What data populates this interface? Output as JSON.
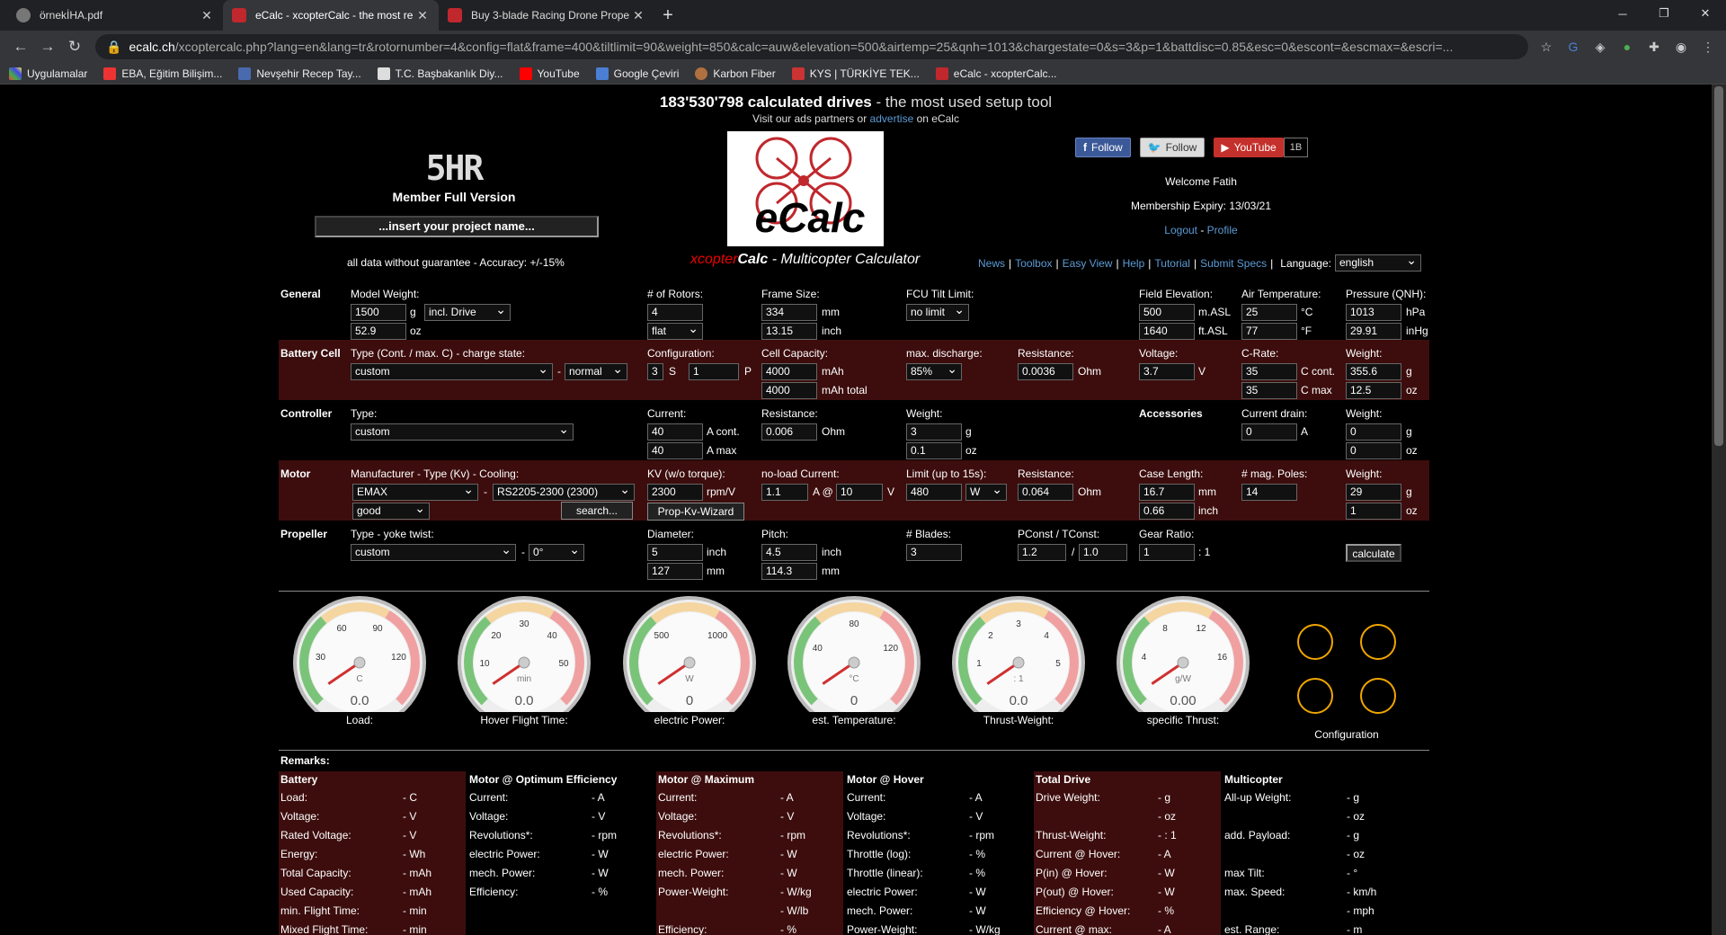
{
  "browser": {
    "tabs": [
      {
        "title": "örnekİHA.pdf",
        "color": "#777"
      },
      {
        "title": "eCalc - xcopterCalc - the most re",
        "color": "#c0282d"
      },
      {
        "title": "Buy 3-blade Racing Drone Prope",
        "color": "#c0282d"
      }
    ],
    "url_host": "ecalc.ch",
    "url_path": "/xcoptercalc.php?lang=en&lang=tr&rotornumber=4&config=flat&frame=400&tiltlimit=90&weight=850&calc=auw&elevation=500&airtemp=25&qnh=1013&chargestate=0&s=3&p=1&battdisc=0.85&esc=0&escont=&escmax=&escri=...",
    "bookmarks": [
      "Uygulamalar",
      "EBA, Eğitim Bilişim...",
      "Nevşehir Recep Tay...",
      "T.C. Başbakanlık Diy...",
      "YouTube",
      "Google Çeviri",
      "Karbon Fiber",
      "KYS | TÜRKİYE TEK...",
      "eCalc - xcopterCalc..."
    ]
  },
  "header": {
    "count": "183'530'798 calculated drives",
    "tagline": " - the most used setup tool",
    "ads_pre": "Visit our ads partners or ",
    "ads_link": "advertise",
    "ads_post": " on eCalc",
    "member_logo": "5HR",
    "member_text": "Member Full Version",
    "project_placeholder": "...insert your project name...",
    "guarantee": "all data without guarantee - Accuracy: +/-15%",
    "subtitle_x": "xcopter",
    "subtitle_calc": "Calc",
    "subtitle_rest": " - Multicopter Calculator",
    "logo_text": "eCalc"
  },
  "social": {
    "facebook": "Follow",
    "twitter": "Follow",
    "youtube": "YouTube",
    "yt_count": "1B"
  },
  "account": {
    "welcome": "Welcome Fatih",
    "expiry": "Membership Expiry: 13/03/21",
    "logout": "Logout",
    "profile": "Profile"
  },
  "nav": {
    "links": [
      "News",
      "Toolbox",
      "Easy View",
      "Help",
      "Tutorial",
      "Submit Specs"
    ],
    "language_label": "Language:",
    "language": "english"
  },
  "general": {
    "title": "General",
    "weight_label": "Model Weight:",
    "weight_g": "1500",
    "unit_g": "g",
    "drive_mode": "incl. Drive",
    "weight_oz": "52.9",
    "unit_oz": "oz",
    "rotors_label": "# of Rotors:",
    "rotors": "4",
    "config": "flat",
    "frame_label": "Frame Size:",
    "frame_mm": "334",
    "unit_mm": "mm",
    "frame_in": "13.15",
    "unit_inch": "inch",
    "tilt_label": "FCU Tilt Limit:",
    "tilt": "no limit",
    "elev_label": "Field Elevation:",
    "elev_m": "500",
    "unit_masl": "m.ASL",
    "elev_ft": "1640",
    "unit_ftasl": "ft.ASL",
    "temp_label": "Air Temperature:",
    "temp_c": "25",
    "unit_c": "°C",
    "temp_f": "77",
    "unit_f": "°F",
    "qnh_label": "Pressure (QNH):",
    "qnh_hpa": "1013",
    "unit_hpa": "hPa",
    "qnh_inhg": "29.91",
    "unit_inhg": "inHg"
  },
  "battery": {
    "title": "Battery Cell",
    "type_label": "Type (Cont. / max. C) - charge state:",
    "type": "custom",
    "charge": "normal",
    "config_label": "Configuration:",
    "s": "3",
    "s_unit": "S",
    "p": "1",
    "p_unit": "P",
    "cap_label": "Cell Capacity:",
    "cap": "4000",
    "cap_unit": "mAh",
    "cap_total": "4000",
    "cap_total_unit": "mAh total",
    "disc_label": "max. discharge:",
    "disc": "85%",
    "res_label": "Resistance:",
    "res": "0.0036",
    "res_unit": "Ohm",
    "volt_label": "Voltage:",
    "volt": "3.7",
    "volt_unit": "V",
    "crate_label": "C-Rate:",
    "c_cont": "35",
    "c_cont_unit": "C cont.",
    "c_max": "35",
    "c_max_unit": "C max",
    "weight_label": "Weight:",
    "weight_g": "355.6",
    "unit_g": "g",
    "weight_oz": "12.5",
    "unit_oz": "oz"
  },
  "controller": {
    "title": "Controller",
    "type_label": "Type:",
    "type": "custom",
    "cur_label": "Current:",
    "cur_cont": "40",
    "cur_cont_unit": "A cont.",
    "cur_max": "40",
    "cur_max_unit": "A max",
    "res_label": "Resistance:",
    "res": "0.006",
    "res_unit": "Ohm",
    "weight_label": "Weight:",
    "weight_g": "3",
    "unit_g": "g",
    "weight_oz": "0.1",
    "unit_oz": "oz",
    "acc_title": "Accessories",
    "drain_label": "Current drain:",
    "drain": "0",
    "drain_unit": "A",
    "acc_weight_label": "Weight:",
    "acc_weight_g": "0",
    "acc_unit_g": "g",
    "acc_weight_oz": "0",
    "acc_unit_oz": "oz"
  },
  "motor": {
    "title": "Motor",
    "mfr_label": "Manufacturer - Type (Kv) - Cooling:",
    "mfr": "EMAX",
    "type": "RS2205-2300 (2300)",
    "cooling": "good",
    "search": "search...",
    "kv_label": "KV (w/o torque):",
    "kv": "2300",
    "kv_unit": "rpm/V",
    "wizard": "Prop-Kv-Wizard",
    "nl_label": "no-load Current:",
    "nl_a": "1.1",
    "nl_at": "A @",
    "nl_v": "10",
    "nl_v_unit": "V",
    "limit_label": "Limit (up to 15s):",
    "limit": "480",
    "limit_unit": "W",
    "res_label": "Resistance:",
    "res": "0.064",
    "res_unit": "Ohm",
    "case_label": "Case Length:",
    "case_mm": "16.7",
    "unit_mm": "mm",
    "case_in": "0.66",
    "unit_inch": "inch",
    "poles_label": "# mag. Poles:",
    "poles": "14",
    "weight_label": "Weight:",
    "weight_g": "29",
    "unit_g": "g",
    "weight_oz": "1",
    "unit_oz": "oz"
  },
  "propeller": {
    "title": "Propeller",
    "type_label": "Type - yoke twist:",
    "type": "custom",
    "twist": "0°",
    "dia_label": "Diameter:",
    "dia_in": "5",
    "unit_inch": "inch",
    "dia_mm": "127",
    "unit_mm": "mm",
    "pitch_label": "Pitch:",
    "pitch_in": "4.5",
    "pitch_mm": "114.3",
    "blades_label": "# Blades:",
    "blades": "3",
    "pconst_label": "PConst / TConst:",
    "pconst": "1.2",
    "slash": "/",
    "tconst": "1.0",
    "gear_label": "Gear Ratio:",
    "gear": "1",
    "gear_unit": ": 1",
    "calculate": "calculate"
  },
  "gauges": [
    {
      "caption": "Load:",
      "unit": "C",
      "value": "0.0",
      "ticks": [
        "30",
        "60",
        "90",
        "120"
      ],
      "level": 0
    },
    {
      "caption": "Hover Flight Time:",
      "unit": "min",
      "value": "0.0",
      "ticks": [
        "10",
        "20",
        "30",
        "40",
        "50"
      ],
      "level": 0
    },
    {
      "caption": "electric Power:",
      "unit": "W",
      "value": "0",
      "ticks": [
        "500",
        "1000"
      ],
      "level": 0
    },
    {
      "caption": "est. Temperature:",
      "unit": "°C",
      "value": "0",
      "ticks": [
        "40",
        "80",
        "120"
      ],
      "level": 0
    },
    {
      "caption": "Thrust-Weight:",
      "unit": ": 1",
      "value": "0.0",
      "ticks": [
        "1",
        "2",
        "3",
        "4",
        "5"
      ],
      "level": 0
    },
    {
      "caption": "specific Thrust:",
      "unit": "g/W",
      "value": "0.00",
      "ticks": [
        "4",
        "8",
        "12",
        "16"
      ],
      "level": 0
    }
  ],
  "config_caption": "Configuration",
  "remarks_label": "Remarks:",
  "results": [
    {
      "title": "Battery",
      "dark": true,
      "rows": [
        [
          "Load:",
          "- C"
        ],
        [
          "Voltage:",
          "- V"
        ],
        [
          "Rated Voltage:",
          "- V"
        ],
        [
          "Energy:",
          "- Wh"
        ],
        [
          "Total Capacity:",
          "- mAh"
        ],
        [
          "Used Capacity:",
          "- mAh"
        ],
        [
          "min. Flight Time:",
          "- min"
        ],
        [
          "Mixed Flight Time:",
          "- min"
        ]
      ]
    },
    {
      "title": "Motor @ Optimum Efficiency",
      "dark": false,
      "rows": [
        [
          "Current:",
          "- A"
        ],
        [
          "Voltage:",
          "- V"
        ],
        [
          "Revolutions*:",
          "- rpm"
        ],
        [
          "electric Power:",
          "- W"
        ],
        [
          "mech. Power:",
          "- W"
        ],
        [
          "Efficiency:",
          "- %"
        ]
      ]
    },
    {
      "title": "Motor @ Maximum",
      "dark": true,
      "rows": [
        [
          "Current:",
          "- A"
        ],
        [
          "Voltage:",
          "- V"
        ],
        [
          "Revolutions*:",
          "- rpm"
        ],
        [
          "electric Power:",
          "- W"
        ],
        [
          "mech. Power:",
          "- W"
        ],
        [
          "Power-Weight:",
          "- W/kg"
        ],
        [
          "",
          "- W/lb"
        ],
        [
          "Efficiency:",
          "- %"
        ]
      ]
    },
    {
      "title": "Motor @ Hover",
      "dark": false,
      "rows": [
        [
          "Current:",
          "- A"
        ],
        [
          "Voltage:",
          "- V"
        ],
        [
          "Revolutions*:",
          "- rpm"
        ],
        [
          "Throttle (log):",
          "- %"
        ],
        [
          "Throttle (linear):",
          "- %"
        ],
        [
          "electric Power:",
          "- W"
        ],
        [
          "mech. Power:",
          "- W"
        ],
        [
          "Power-Weight:",
          "- W/kg"
        ]
      ]
    },
    {
      "title": "Total Drive",
      "dark": true,
      "rows": [
        [
          "Drive Weight:",
          "- g"
        ],
        [
          "",
          "- oz"
        ],
        [
          "Thrust-Weight:",
          "- : 1"
        ],
        [
          "Current @ Hover:",
          "- A"
        ],
        [
          "P(in) @ Hover:",
          "- W"
        ],
        [
          "P(out) @ Hover:",
          "- W"
        ],
        [
          "Efficiency @ Hover:",
          "- %"
        ],
        [
          "Current @ max:",
          "- A"
        ]
      ]
    },
    {
      "title": "Multicopter",
      "dark": false,
      "rows": [
        [
          "All-up Weight:",
          "- g"
        ],
        [
          "",
          "- oz"
        ],
        [
          "add. Payload:",
          "- g"
        ],
        [
          "",
          "- oz"
        ],
        [
          "max Tilt:",
          "- °"
        ],
        [
          "max. Speed:",
          "- km/h"
        ],
        [
          "",
          "- mph"
        ],
        [
          "est. Range:",
          "- m"
        ]
      ]
    }
  ]
}
